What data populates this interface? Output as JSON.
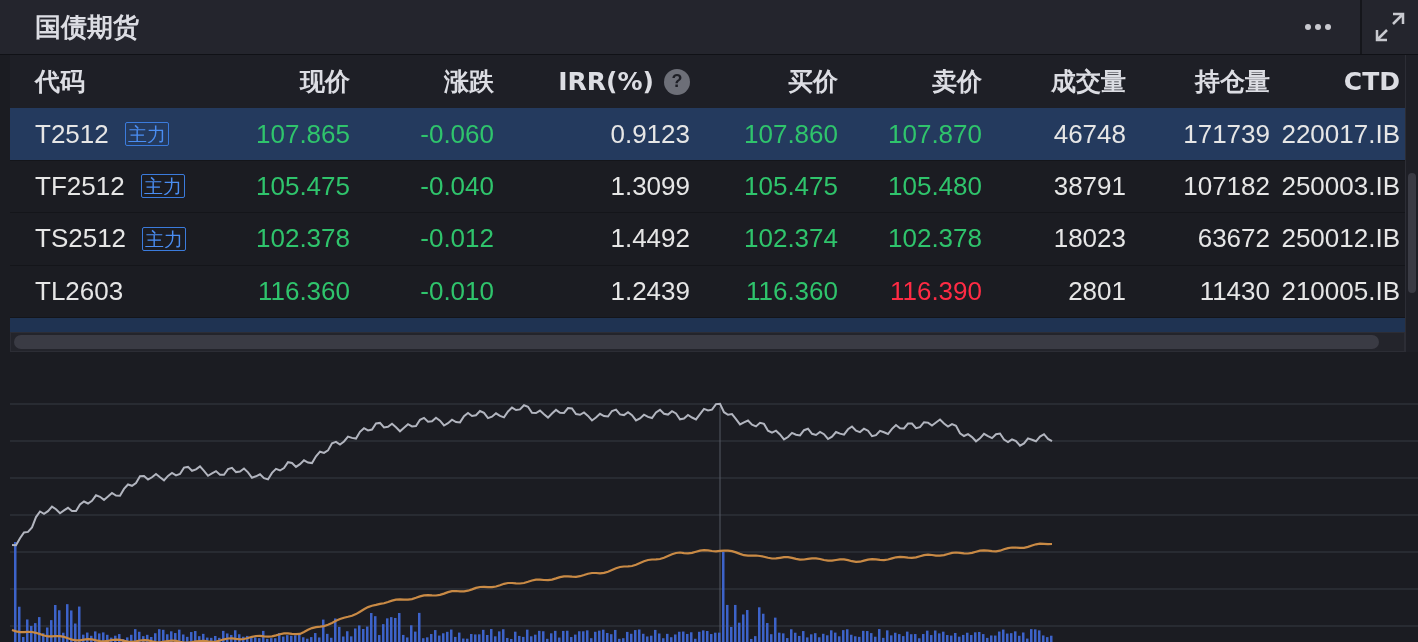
{
  "panel": {
    "title": "国债期货"
  },
  "table": {
    "columns": [
      {
        "label": "代码"
      },
      {
        "label": "现价"
      },
      {
        "label": "涨跌"
      },
      {
        "label": "IRR(%)",
        "help_icon": "?"
      },
      {
        "label": "买价"
      },
      {
        "label": "卖价"
      },
      {
        "label": "成交量"
      },
      {
        "label": "持仓量"
      },
      {
        "label": "CTD"
      }
    ],
    "rows": [
      {
        "selected": true,
        "code": "T2512",
        "badge": "主力",
        "price": "107.865",
        "change": "-0.060",
        "irr": "0.9123",
        "bid": "107.860",
        "ask": {
          "text": "107.870",
          "color": "#2fc46c"
        },
        "volume": "46748",
        "open_interest": "171739",
        "ctd": "220017.IB"
      },
      {
        "selected": false,
        "code": "TF2512",
        "badge": "主力",
        "price": "105.475",
        "change": "-0.040",
        "irr": "1.3099",
        "bid": "105.475",
        "ask": {
          "text": "105.480",
          "color": "#2fc46c"
        },
        "volume": "38791",
        "open_interest": "107182",
        "ctd": "250003.IB"
      },
      {
        "selected": false,
        "code": "TS2512",
        "badge": "主力",
        "price": "102.378",
        "change": "-0.012",
        "irr": "1.4492",
        "bid": "102.374",
        "ask": {
          "text": "102.378",
          "color": "#2fc46c"
        },
        "volume": "18023",
        "open_interest": "63672",
        "ctd": "250012.IB"
      },
      {
        "selected": false,
        "code": "TL2603",
        "price": "116.360",
        "change": "-0.010",
        "irr": "1.2439",
        "bid": "116.360",
        "ask": {
          "text": "116.390",
          "color": "#ff2b44"
        },
        "volume": "2801",
        "open_interest": "11430",
        "ctd": "210005.IB"
      }
    ]
  }
}
